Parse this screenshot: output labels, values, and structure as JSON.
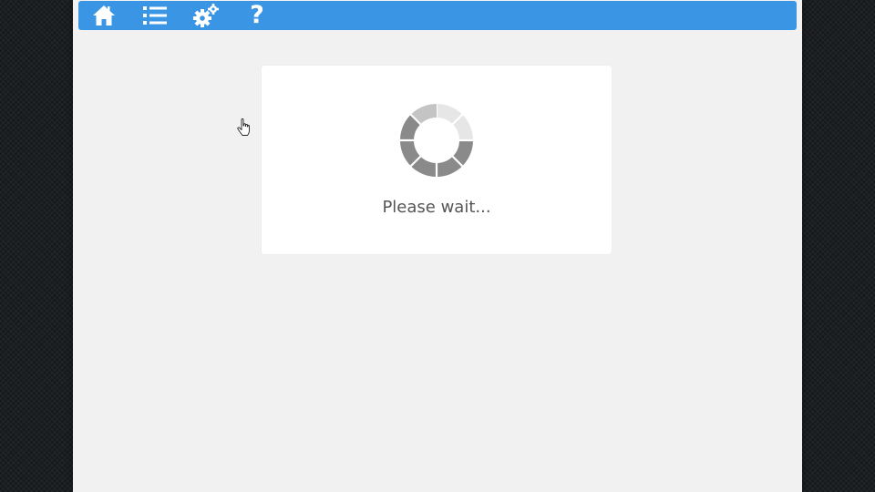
{
  "toolbar": {
    "color": "#3a95e4",
    "buttons": [
      {
        "name": "home",
        "icon": "home-icon"
      },
      {
        "name": "menu",
        "icon": "list-icon"
      },
      {
        "name": "settings",
        "icon": "gears-icon"
      },
      {
        "name": "help",
        "icon": "help-icon",
        "glyph": "?"
      }
    ]
  },
  "dialog": {
    "message": "Please wait...",
    "spinner": {
      "icon": "loading-spinner-icon",
      "segments": 8,
      "colors": [
        "#e6e6e6",
        "#e6e6e6",
        "#8a8a8a",
        "#8a8a8a",
        "#8a8a8a",
        "#8a8a8a",
        "#8a8a8a",
        "#c4c4c4"
      ]
    }
  },
  "cursor": {
    "icon": "hand-pointer-icon"
  }
}
